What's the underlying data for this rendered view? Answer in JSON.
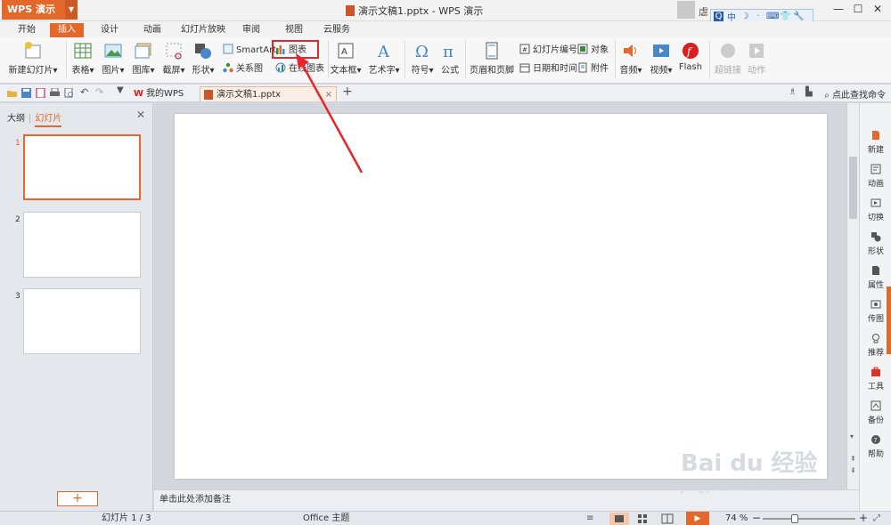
{
  "titlebar": {
    "app_name": "WPS 演示",
    "doc_title": "演示文稿1.pptx - WPS 演示",
    "user_name": "虐",
    "ime": [
      "中",
      "☽",
      "·",
      "⌨",
      "👕",
      "🔧"
    ]
  },
  "tabs": [
    "开始",
    "插入",
    "设计",
    "动画",
    "幻灯片放映",
    "审阅",
    "视图",
    "云服务"
  ],
  "active_tab": "插入",
  "ribbon": {
    "new_slide": "新建幻灯片",
    "table": "表格",
    "picture": "图片",
    "gallery": "图库",
    "screenshot": "截屏",
    "shape": "形状",
    "smartart": "SmartArt",
    "chart": "图表",
    "relation": "关系图",
    "online_chart": "在线图表",
    "textbox": "文本框",
    "wordart": "艺术字",
    "symbol": "符号",
    "formula": "公式",
    "header_footer": "页眉和页脚",
    "slide_number": "幻灯片编号",
    "object": "对象",
    "date_time": "日期和时间",
    "attachment": "附件",
    "audio": "音频",
    "video": "视频",
    "flash": "Flash",
    "hyperlink": "超链接",
    "action": "动作",
    "dropdown_mark": "▾"
  },
  "qabar": {
    "tab_mywps": "我的WPS",
    "tab_doc": "演示文稿1.pptx",
    "close": "×",
    "new_tab": "+",
    "find_cmd": "点此查找命令"
  },
  "leftpanel": {
    "tab_outline": "大纲",
    "tab_slides": "幻灯片",
    "close": "✕",
    "slide_numbers": [
      "1",
      "2",
      "3"
    ],
    "add": "+"
  },
  "notes_placeholder": "单击此处添加备注",
  "rightpanel": [
    "新建",
    "动画",
    "切换",
    "形状",
    "属性",
    "传图",
    "推荐",
    "工具",
    "备份",
    "帮助"
  ],
  "statusbar": {
    "slide_info": "幻灯片 1 / 3",
    "theme": "Office 主题",
    "zoom": "74 %",
    "minus": "−",
    "plus": "+",
    "play": "▶"
  },
  "watermark": {
    "line1": "Bai du 经验",
    "line2": "jingyan.baidu.com"
  },
  "colors": {
    "accent": "#e2692b",
    "highlight": "#e8262a"
  }
}
